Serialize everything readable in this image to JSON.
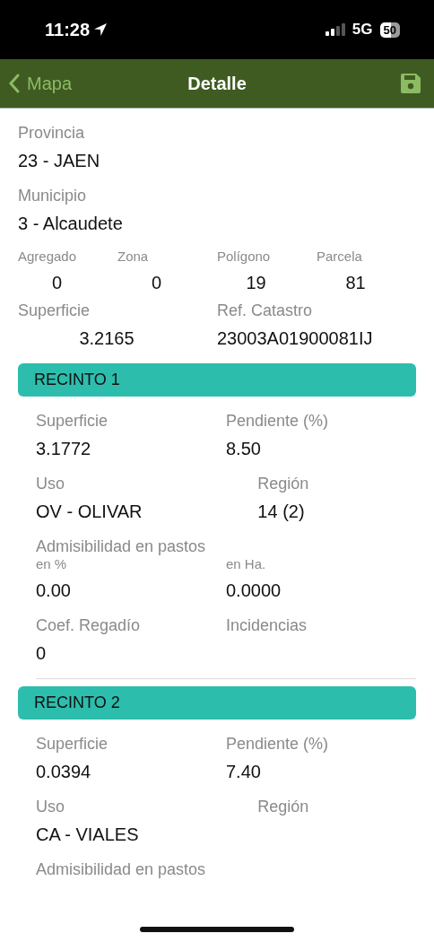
{
  "status_bar": {
    "time": "11:28",
    "network": "5G",
    "battery": "50"
  },
  "nav": {
    "back_label": "Mapa",
    "title": "Detalle"
  },
  "summary": [
    {
      "label": "Provincia",
      "value": "23 - JAEN"
    },
    {
      "label": "Municipio",
      "value": "3 - Alcaudete"
    }
  ],
  "codes": [
    {
      "label": "Agregado",
      "value": "0"
    },
    {
      "label": "Zona",
      "value": "0"
    },
    {
      "label": "Polígono",
      "value": "19"
    },
    {
      "label": "Parcela",
      "value": "81"
    }
  ],
  "totals": [
    {
      "label": "Superficie",
      "value": "3.2165"
    },
    {
      "label": "Ref. Catastro",
      "value": "23003A01900081IJ"
    }
  ],
  "recintos": [
    {
      "title": "RECINTO 1",
      "rows": [
        {
          "kind": "pair",
          "cells": [
            {
              "label": "Superficie",
              "value": "3.1772"
            },
            {
              "label": "Pendiente (%)",
              "value": "8.50"
            }
          ]
        },
        {
          "kind": "split",
          "cells": [
            {
              "label": "Uso",
              "value": "OV - OLIVAR"
            },
            {
              "label": "Región",
              "value": "14 (2)"
            }
          ]
        },
        {
          "kind": "group",
          "heading": "Admisibilidad en pastos",
          "cells": [
            {
              "label": "en %",
              "value": "0.00"
            },
            {
              "label": "en Ha.",
              "value": "0.0000"
            }
          ]
        },
        {
          "kind": "pair",
          "cells": [
            {
              "label": "Coef. Regadío",
              "value": "0"
            },
            {
              "label": "Incidencias"
            }
          ]
        }
      ]
    },
    {
      "title": "RECINTO 2",
      "rows": [
        {
          "kind": "pair",
          "cells": [
            {
              "label": "Superficie",
              "value": "0.0394"
            },
            {
              "label": "Pendiente (%)",
              "value": "7.40"
            }
          ]
        },
        {
          "kind": "split",
          "cells": [
            {
              "label": "Uso",
              "value": "CA - VIALES"
            },
            {
              "label": "Región"
            }
          ]
        },
        {
          "kind": "group",
          "heading": "Admisibilidad en pastos"
        }
      ]
    }
  ]
}
